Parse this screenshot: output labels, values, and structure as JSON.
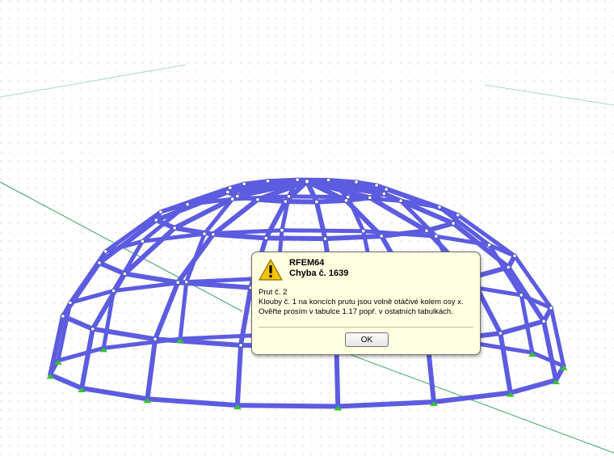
{
  "dialog": {
    "app_name": "RFEM64",
    "error_code": "Chyba č. 1639",
    "message_lines": [
      "Prut č. 2",
      "Klouby č. 1 na koncích prutu jsou volně otáčivé kolem osy x.",
      "Ověřte prosím v tabulce 1.17 popř. v ostatních tabulkách."
    ],
    "ok_label": "OK",
    "icon": "warning-icon"
  },
  "colors": {
    "member": "#5c5ce0",
    "member_edge": "#3a3aa8",
    "support": "#31c331",
    "grid_dot": "#b4b4b4",
    "axis_line": "#3aa06a",
    "dialog_bg": "#ffffe1",
    "warning_fill": "#f5c400"
  }
}
